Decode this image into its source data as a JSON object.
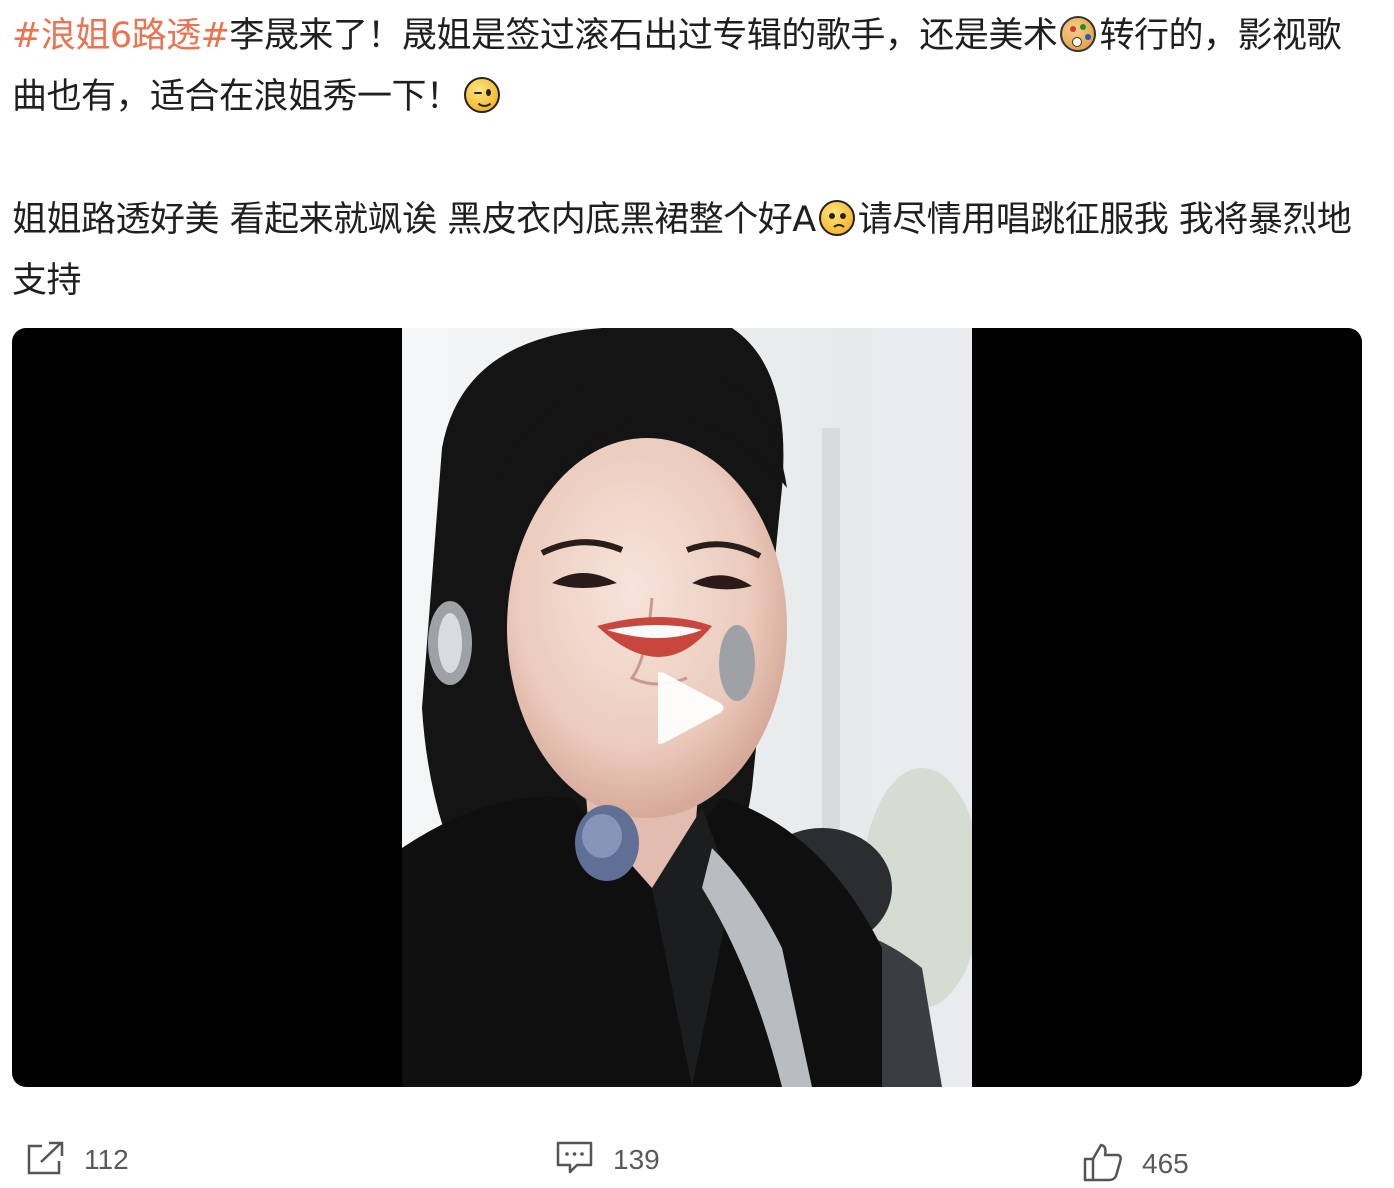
{
  "post": {
    "hashtag": "#浪姐6路透#",
    "line1_a": "李晟来了！晟姐是签过滚石出过专辑的歌手，还是美术",
    "line1_b": "转行的，影视歌曲也有，适合在浪姐秀一下！",
    "line2_a": "姐姐路透好美 看起来就飒诶 黑皮衣内底黑裙整个好A",
    "line2_b": "请尽情用唱跳征服我 我将暴烈地支持",
    "emojis": [
      "palette-emoji-icon",
      "wink-emoji-icon",
      "sad-emoji-icon"
    ],
    "accent_color": "#eb7350"
  },
  "video": {
    "controls": [
      "play-icon"
    ]
  },
  "actions": {
    "repost": {
      "icon": "repost-icon",
      "count": "112"
    },
    "comment": {
      "icon": "comment-icon",
      "count": "139"
    },
    "like": {
      "icon": "like-icon",
      "count": "465"
    }
  }
}
